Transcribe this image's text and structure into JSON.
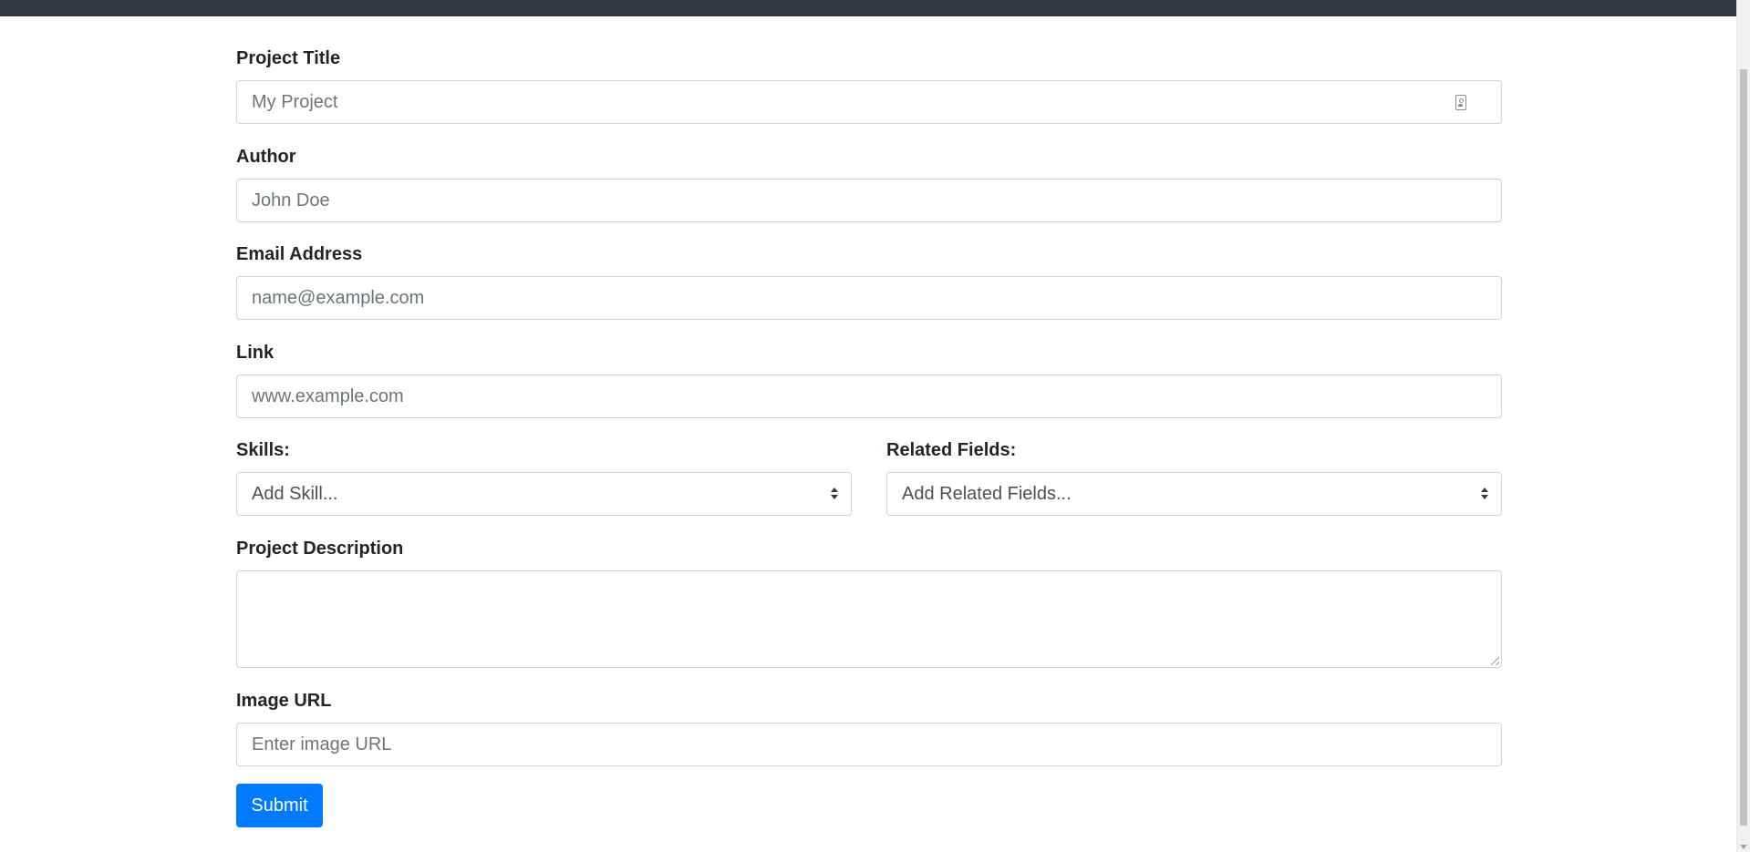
{
  "form": {
    "project_title": {
      "label": "Project Title",
      "placeholder": "My Project"
    },
    "author": {
      "label": "Author",
      "placeholder": "John Doe"
    },
    "email": {
      "label": "Email Address",
      "placeholder": "name@example.com"
    },
    "link": {
      "label": "Link",
      "placeholder": "www.example.com"
    },
    "skills": {
      "label": "Skills:",
      "selected": "Add Skill..."
    },
    "related_fields": {
      "label": "Related Fields:",
      "selected": "Add Related Fields..."
    },
    "description": {
      "label": "Project Description",
      "value": ""
    },
    "image_url": {
      "label": "Image URL",
      "placeholder": "Enter image URL"
    },
    "submit_label": "Submit"
  },
  "colors": {
    "navbar": "#343a40",
    "primary": "#007bff",
    "border": "#ced4da",
    "placeholder": "#6c757d"
  },
  "icons": {
    "project_title_field": "contact-card-icon",
    "select_arrows": "sort-arrows-icon"
  }
}
